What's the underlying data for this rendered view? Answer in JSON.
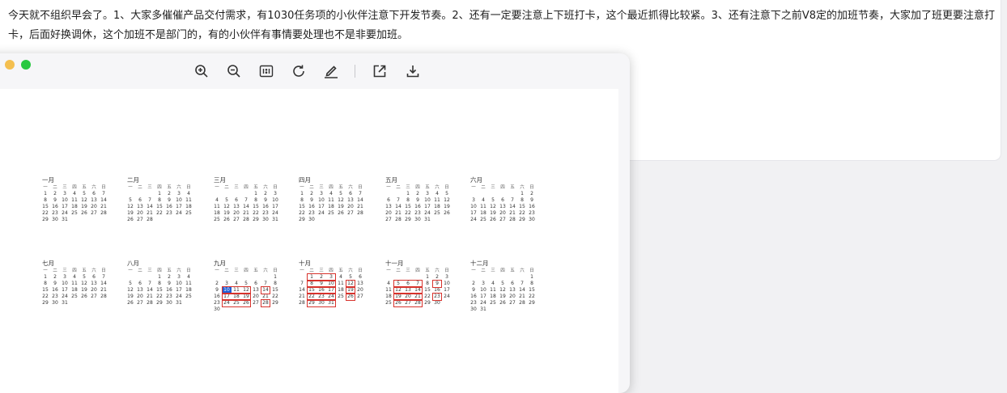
{
  "message": {
    "text": "今天就不组织早会了。1、大家多催催产品交付需求，有1030任务项的小伙伴注意下开发节奏。2、还有一定要注意上下班打卡，这个最近抓得比较紧。3、还有注意下之前V8定的加班节奏，大家加了班更要注意打卡，后面好换调休，这个加班不是部门的，有的小伙伴有事情要处理也不是非要加班。"
  },
  "window": {
    "traffic_lights": [
      {
        "name": "minimize",
        "color": "#f4bf4f"
      },
      {
        "name": "zoom",
        "color": "#28c840"
      }
    ]
  },
  "toolbar": {
    "buttons": [
      {
        "name": "zoom-in",
        "icon": "zoom-in-icon"
      },
      {
        "name": "zoom-out",
        "icon": "zoom-out-icon"
      },
      {
        "name": "actual-size",
        "icon": "actual-size-icon",
        "label": "1:1"
      },
      {
        "name": "rotate",
        "icon": "rotate-icon"
      },
      {
        "name": "annotate",
        "icon": "pen-icon"
      },
      {
        "name": "open-external",
        "icon": "open-external-icon"
      },
      {
        "name": "download",
        "icon": "download-icon"
      }
    ]
  },
  "calendar": {
    "weekdays": [
      "一",
      "二",
      "三",
      "四",
      "五",
      "六",
      "日"
    ],
    "highlight_color": "#d7322c",
    "today_color": "#1f5fd6",
    "months": [
      {
        "name": "一月",
        "offset": 0,
        "days": 31,
        "row": 0,
        "col": 0
      },
      {
        "name": "二月",
        "offset": 3,
        "days": 28,
        "row": 0,
        "col": 1
      },
      {
        "name": "三月",
        "offset": 4,
        "days": 31,
        "row": 0,
        "col": 2
      },
      {
        "name": "四月",
        "offset": 0,
        "days": 30,
        "row": 0,
        "col": 3
      },
      {
        "name": "五月",
        "offset": 2,
        "days": 31,
        "row": 0,
        "col": 4
      },
      {
        "name": "六月",
        "offset": 5,
        "days": 30,
        "row": 0,
        "col": 5
      },
      {
        "name": "七月",
        "offset": 0,
        "days": 31,
        "row": 1,
        "col": 0
      },
      {
        "name": "八月",
        "offset": 3,
        "days": 31,
        "row": 1,
        "col": 1
      },
      {
        "name": "九月",
        "offset": 6,
        "days": 30,
        "row": 1,
        "col": 2,
        "today": 10,
        "marks": [
          [
            10,
            12
          ],
          [
            14,
            14
          ],
          [
            17,
            19
          ],
          [
            24,
            26
          ],
          [
            28,
            28
          ]
        ]
      },
      {
        "name": "十月",
        "offset": 1,
        "days": 31,
        "row": 1,
        "col": 3,
        "marks": [
          [
            1,
            3
          ],
          [
            8,
            10
          ],
          [
            12,
            12
          ],
          [
            15,
            17
          ],
          [
            19,
            19
          ],
          [
            22,
            24
          ],
          [
            26,
            26
          ],
          [
            29,
            31
          ]
        ]
      },
      {
        "name": "十一月",
        "offset": 4,
        "days": 30,
        "row": 1,
        "col": 4,
        "marks": [
          [
            5,
            7
          ],
          [
            9,
            9
          ],
          [
            12,
            14
          ],
          [
            19,
            21
          ],
          [
            23,
            23
          ],
          [
            26,
            28
          ]
        ]
      },
      {
        "name": "十二月",
        "offset": 6,
        "days": 31,
        "row": 1,
        "col": 5
      }
    ]
  }
}
